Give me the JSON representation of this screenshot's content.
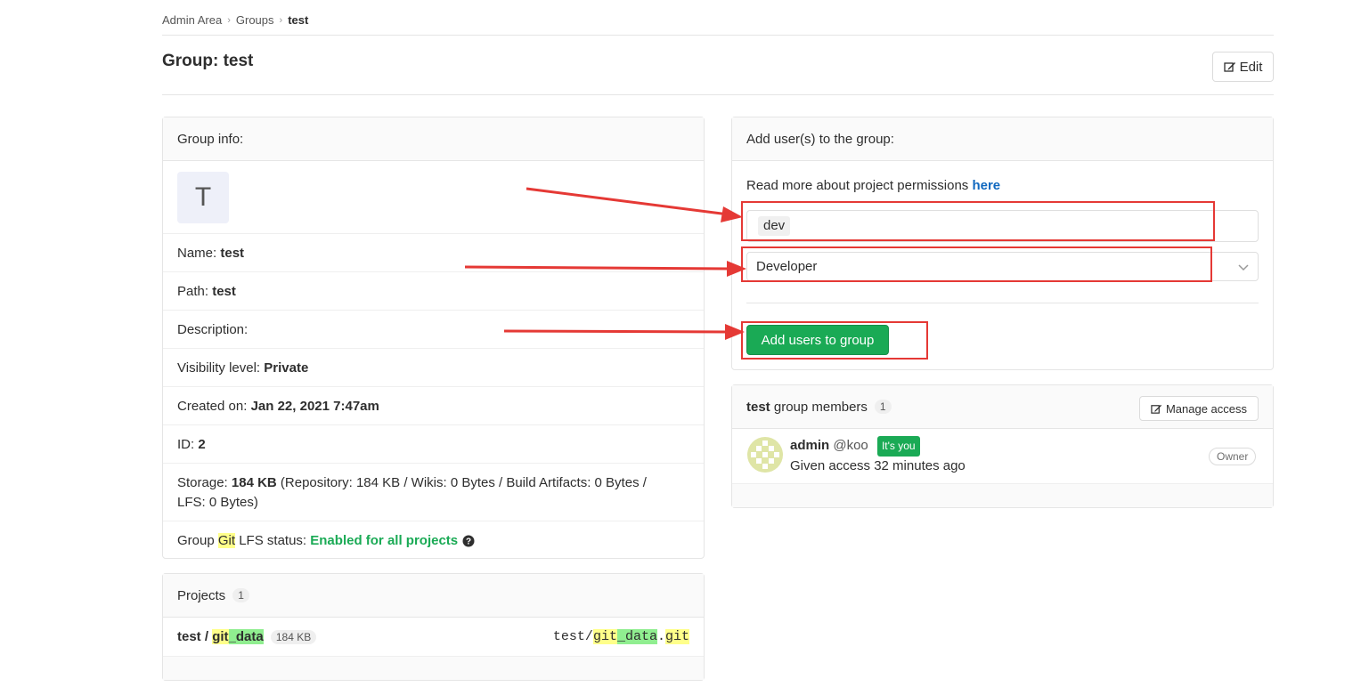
{
  "breadcrumb": {
    "items": [
      "Admin Area",
      "Groups"
    ],
    "current": "test"
  },
  "page": {
    "title": "Group: test",
    "edit_label": "Edit"
  },
  "group_info": {
    "header": "Group info:",
    "avatar_letter": "T",
    "name_label": "Name:",
    "name_value": "test",
    "path_label": "Path:",
    "path_value": "test",
    "description_label": "Description:",
    "visibility_label": "Visibility level:",
    "visibility_value": "Private",
    "created_label": "Created on:",
    "created_value": "Jan 22, 2021 7:47am",
    "id_label": "ID:",
    "id_value": "2",
    "storage_label": "Storage:",
    "storage_value": "184 KB",
    "storage_detail": "(Repository: 184 KB / Wikis: 0 Bytes / Build Artifacts: 0 Bytes /",
    "storage_detail2": "LFS: 0 Bytes)",
    "lfs_prefix": "Group",
    "lfs_git": "Git",
    "lfs_suffix": "LFS status:",
    "lfs_value": "Enabled for all projects"
  },
  "projects": {
    "header": "Projects",
    "count": "1",
    "item": {
      "namespace": "test /",
      "name_git": "git",
      "name_rest": "_data",
      "size": "184 KB",
      "path_ns": "test/",
      "path_git": "git",
      "path_mid": "_data",
      "path_dot": ".",
      "path_ext": "git"
    }
  },
  "add_users": {
    "header": "Add user(s) to the group:",
    "permissions_text": "Read more about project permissions",
    "permissions_link": "here",
    "user_token": "dev",
    "role_value": "Developer",
    "submit_label": "Add users to group"
  },
  "members": {
    "group_name": "test",
    "header_suffix": "group members",
    "count": "1",
    "manage_label": "Manage access",
    "member": {
      "name": "admin",
      "username": "@koo",
      "you_badge": "It's you",
      "access": "Given access 32 minutes ago",
      "role": "Owner"
    }
  },
  "colors": {
    "accent_green": "#1aaa55",
    "link_blue": "#1068bf",
    "annotation_red": "#e53935"
  },
  "icons": [
    "chevron-right-icon",
    "pencil-square-icon",
    "question-circle-icon",
    "chevron-down-icon",
    "identicon-avatar-icon",
    "arrow-annotation-icon"
  ]
}
